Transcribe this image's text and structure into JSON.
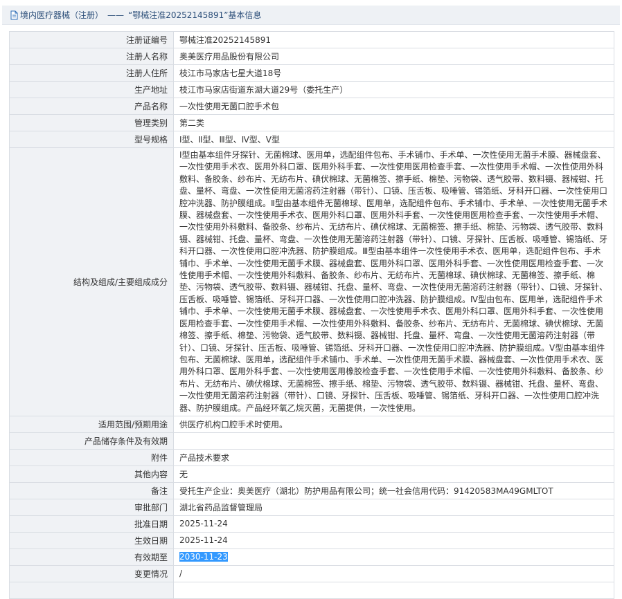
{
  "header": {
    "icon": "document-icon",
    "category": "境内医疗器械（注册）",
    "separator": "——",
    "title": "“鄂械注准20252145891”基本信息"
  },
  "rows": [
    {
      "label": "注册证编号",
      "value": "鄂械注准20252145891"
    },
    {
      "label": "注册人名称",
      "value": "奥美医疗用品股份有限公司"
    },
    {
      "label": "注册人住所",
      "value": "枝江市马家店七星大道18号"
    },
    {
      "label": "生产地址",
      "value": "枝江市马家店街道东湖大道29号（委托生产）"
    },
    {
      "label": "产品名称",
      "value": "一次性使用无菌口腔手术包"
    },
    {
      "label": "管理类别",
      "value": "第二类"
    },
    {
      "label": "型号规格",
      "value": "Ⅰ型、Ⅱ型、Ⅲ型、Ⅳ型、Ⅴ型"
    },
    {
      "label": "结构及组成/主要组成成分",
      "value": "Ⅰ型由基本组件牙探针、无菌棉球、医用单，选配组件包布、手术铺巾、手术单、一次性使用无菌手术膜、器械盘套、一次性使用手术衣、医用外科口罩、医用外科手套、一次性使用医用检查手套、一次性使用手术帽、一次性使用外科敷料、备胶条、纱布片、无纺布片、碘伏棉球、无菌棉签、擦手纸、棉垫、污物袋、透气胶带、数料镊、器械钳、托盘、量杯、弯盘、一次性使用无菌溶药注射器（带针）、口镜、压舌板、吸唾管、锡箔纸、牙科开口器、一次性使用口腔冲洗器、防护膜组成。Ⅱ型由基本组件无菌棉球、医用单，选配组件包布、手术铺巾、手术单、一次性使用无菌手术膜、器械盘套、一次性使用手术衣、医用外科口罩、医用外科手套、一次性使用医用检查手套、一次性使用手术帽、一次性使用外科敷料、备胶条、纱布片、无纺布片、碘伏棉球、无菌棉签、擦手纸、棉垫、污物袋、透气胶带、数料镊、器械钳、托盘、量杯、弯盘、一次性使用无菌溶药注射器（带针）、口镜、牙探针、压舌板、吸唾管、锡箔纸、牙科开口器、一次性使用口腔冲洗器、防护膜组成。Ⅲ型由基本组件一次性使用手术衣、医用单，选配组件包布、手术铺巾、手术单、一次性使用无菌手术膜、器械盘套、医用外科口罩、医用外科手套、一次性使用医用检查手套、一次性使用手术帽、一次性使用外科敷料、备胶条、纱布片、无纺布片、无菌棉球、碘伏棉球、无菌棉签、擦手纸、棉垫、污物袋、透气胶带、数料镊、器械钳、托盘、量杯、弯盘、一次性使用无菌溶药注射器（带针）、口镜、牙探针、压舌板、吸唾管、锡箔纸、牙科开口器、一次性使用口腔冲洗器、防护膜组成。Ⅳ型由包布、医用单，选配组件手术铺巾、手术单、一次性使用无菌手术膜、器械盘套、一次性使用手术衣、医用外科口罩、医用外科手套、一次性使用医用检查手套、一次性使用手术帽、一次性使用外科敷料、备胶条、纱布片、无纺布片、无菌棉球、碘伏棉球、无菌棉签、擦手纸、棉垫、污物袋、透气胶带、数料镊、器械钳、托盘、量杯、弯盘、一次性使用无菌溶药注射器（带针）、口镜、牙探针、压舌板、吸唾管、锡箔纸、牙科开口器、一次性使用口腔冲洗器、防护膜组成。Ⅴ型由基本组件包布、无菌棉球、医用单，选配组件手术铺巾、手术单、一次性使用无菌手术膜、器械盘套、一次性使用手术衣、医用外科口罩、医用外科手套、一次性使用医用橡胶检查手套、一次性使用手术帽、一次性使用外科敷料、备胶条、纱布片、无纺布片、碘伏棉球、无菌棉签、擦手纸、棉垫、污物袋、透气胶带、数料镊、器械钳、托盘、量杯、弯盘、一次性使用无菌溶药注射器（带针）、口镜、牙探针、压舌板、吸唾管、锡箔纸、牙科开口器、一次性使用口腔冲洗器、防护膜组成。产品经环氧乙烷灭菌，无菌提供，一次性使用。"
    },
    {
      "label": "适用范围/预期用途",
      "value": "供医疗机构口腔手术时使用。"
    },
    {
      "label": "产品储存条件及有效期",
      "value": ""
    },
    {
      "label": "附件",
      "value": "产品技术要求"
    },
    {
      "label": "其他内容",
      "value": "无"
    },
    {
      "label": "备注",
      "value": "受托生产企业：奥美医疗（湖北）防护用品有限公司；统一社会信用代码：91420583MA49GMLTOT"
    },
    {
      "label": "审批部门",
      "value": "湖北省药品监督管理局"
    },
    {
      "label": "批准日期",
      "value": "2025-11-24"
    },
    {
      "label": "生效日期",
      "value": "2025-11-24"
    },
    {
      "label": "有效期至",
      "value": "2030-11-23"
    },
    {
      "label": "变更情况",
      "value": "/"
    }
  ],
  "colors": {
    "header_bg": "#eef1f5",
    "header_text": "#2a4d78",
    "label_bg": "#f0f2f5",
    "border": "#d9dde3",
    "selection": "#3399ff"
  }
}
